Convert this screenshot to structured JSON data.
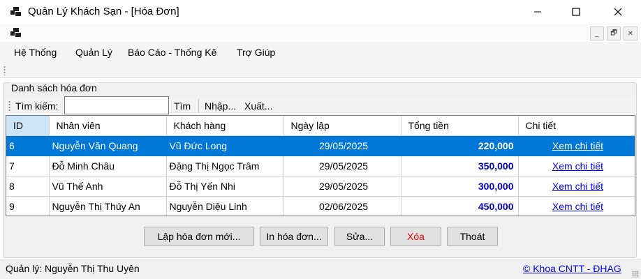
{
  "window": {
    "title": "Quản Lý Khách Sạn - [Hóa Đơn]",
    "icon": "app-window-icon"
  },
  "mdi": {
    "minimize_label": "_",
    "restore_label": "🗗",
    "close_label": "✕"
  },
  "menu": {
    "items": [
      "Hệ Thống",
      "Quản Lý",
      "Báo Cáo - Thống Kê",
      "Trợ Giúp"
    ]
  },
  "group": {
    "title": "Danh sách hóa đơn"
  },
  "search": {
    "label": "Tìm kiếm:",
    "value": "",
    "find_label": "Tìm",
    "import_label": "Nhập...",
    "export_label": "Xuất..."
  },
  "table": {
    "columns": [
      "ID",
      "Nhân viên",
      "Khách hàng",
      "Ngày lập",
      "Tổng tiền",
      "Chi tiết"
    ],
    "rows": [
      {
        "id": "6",
        "staff": "Nguyễn Văn Quang",
        "customer": "Vũ Đức Long",
        "date": "29/05/2025",
        "total": "220,000",
        "detail": "Xem chi tiết"
      },
      {
        "id": "7",
        "staff": "Đỗ Minh Châu",
        "customer": "Đặng Thị Ngọc Trâm",
        "date": "29/05/2025",
        "total": "350,000",
        "detail": "Xem chi tiết"
      },
      {
        "id": "8",
        "staff": "Vũ Thế Anh",
        "customer": "Đỗ Thị Yến Nhi",
        "date": "29/05/2025",
        "total": "300,000",
        "detail": "Xem chi tiết"
      },
      {
        "id": "9",
        "staff": "Nguyễn Thị Thúy An",
        "customer": "Nguyễn Diệu Linh",
        "date": "02/06/2025",
        "total": "450,000",
        "detail": "Xem chi tiết"
      }
    ],
    "selected_row": "6"
  },
  "buttons": {
    "new_invoice": "Lập hóa đơn mới...",
    "print_invoice": "In hóa đơn...",
    "edit": "Sửa...",
    "delete": "Xóa",
    "exit": "Thoát"
  },
  "status": {
    "manager": "Quản lý: Nguyễn Thị Thu Uyên",
    "credit": "© Khoa CNTT - ĐHAG"
  },
  "colors": {
    "selection": "#0078d7",
    "header_highlight": "#cce4f7",
    "money_text": "#0000cc",
    "link": "#0000ff",
    "delete_text": "#e00000"
  }
}
